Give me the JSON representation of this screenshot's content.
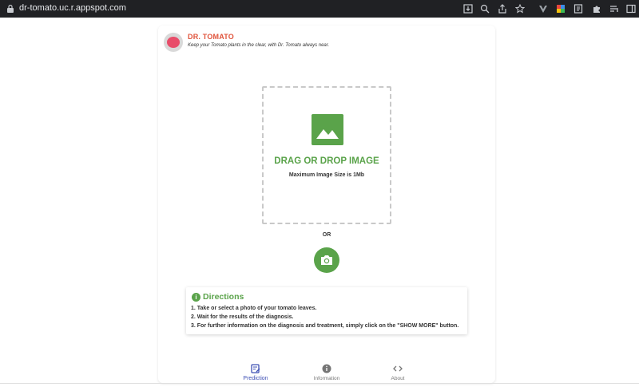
{
  "browser": {
    "url": "dr-tomato.uc.r.appspot.com"
  },
  "brand": {
    "title": "DR. TOMATO",
    "tagline": "Keep your Tomato plants in the clear, with Dr. Tomato always near."
  },
  "dropzone": {
    "title": "DRAG OR DROP IMAGE",
    "subtitle": "Maximum Image Size is 1Mb"
  },
  "or_label": "OR",
  "directions": {
    "title": "Directions",
    "steps": [
      "1. Take or select a photo of your tomato leaves.",
      "2. Wait for the results of the diagnosis.",
      "3. For further information on the diagnosis and treatment, simply click on the \"SHOW MORE\" button."
    ]
  },
  "nav": {
    "items": [
      {
        "label": "Prediction",
        "icon": "prediction-icon",
        "active": true
      },
      {
        "label": "Information",
        "icon": "info-icon",
        "active": false
      },
      {
        "label": "About",
        "icon": "code-icon",
        "active": false
      }
    ]
  },
  "colors": {
    "accent_green": "#5aa34a",
    "brand_red": "#e0543c",
    "nav_active": "#3f51b5"
  }
}
